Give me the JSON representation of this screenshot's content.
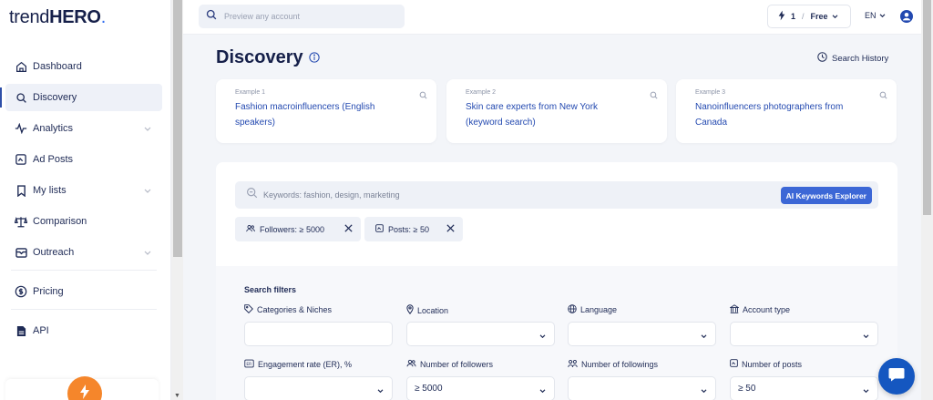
{
  "app": {
    "logo_prefix": "trend",
    "logo_strong": "HERO",
    "logo_dot": "."
  },
  "sidebar": {
    "items": [
      {
        "label": "Dashboard",
        "icon": "home-icon",
        "active": false,
        "expandable": false
      },
      {
        "label": "Discovery",
        "icon": "search-icon",
        "active": true,
        "expandable": false
      },
      {
        "label": "Analytics",
        "icon": "pulse-icon",
        "active": false,
        "expandable": true
      },
      {
        "label": "Ad Posts",
        "icon": "image-icon",
        "active": false,
        "expandable": false
      },
      {
        "label": "My lists",
        "icon": "bookmark-icon",
        "active": false,
        "expandable": true
      },
      {
        "label": "Comparison",
        "icon": "scales-icon",
        "active": false,
        "expandable": false
      },
      {
        "label": "Outreach",
        "icon": "mail-icon",
        "active": false,
        "expandable": true
      },
      {
        "label": "Pricing",
        "icon": "dollar-circle-icon",
        "active": false,
        "expandable": false
      },
      {
        "label": "API",
        "icon": "document-icon",
        "active": false,
        "expandable": false
      }
    ]
  },
  "topbar": {
    "search_placeholder": "Preview any account",
    "plan_count": "1",
    "plan_separator": "/",
    "plan_name": "Free",
    "language": "EN"
  },
  "page": {
    "title": "Discovery",
    "search_history": "Search History"
  },
  "examples": [
    {
      "label": "Example 1",
      "text": "Fashion macroinfluencers (English speakers)"
    },
    {
      "label": "Example 2",
      "text": "Skin care experts from New York (keyword search)"
    },
    {
      "label": "Example 3",
      "text": "Nanoinfluencers photographers from Canada"
    }
  ],
  "keywords": {
    "placeholder": "Keywords: fashion, design, marketing",
    "ai_button": "AI Keywords Explorer"
  },
  "chips": [
    {
      "label": "Followers: ≥ 5000",
      "icon": "users-icon"
    },
    {
      "label": "Posts: ≥ 50",
      "icon": "image-icon"
    }
  ],
  "filters": {
    "title": "Search filters",
    "fields": [
      {
        "label": "Categories & Niches",
        "icon": "tag-icon",
        "value": "",
        "dropdown": false
      },
      {
        "label": "Location",
        "icon": "pin-icon",
        "value": "",
        "dropdown": true
      },
      {
        "label": "Language",
        "icon": "globe-icon",
        "value": "",
        "dropdown": true
      },
      {
        "label": "Account type",
        "icon": "building-icon",
        "value": "",
        "dropdown": true
      },
      {
        "label": "Engagement rate (ER), %",
        "icon": "er-icon",
        "value": "",
        "dropdown": true
      },
      {
        "label": "Number of followers",
        "icon": "users-icon",
        "value": "≥ 5000",
        "dropdown": true
      },
      {
        "label": "Number of followings",
        "icon": "followings-icon",
        "value": "",
        "dropdown": true
      },
      {
        "label": "Number of posts",
        "icon": "image-icon",
        "value": "≥ 50",
        "dropdown": true
      }
    ]
  },
  "colors": {
    "brand": "#1e2a55",
    "accent": "#2349b0",
    "ai_button": "#3c67d6",
    "bolt": "#f5862b",
    "chat": "#1557c0"
  }
}
